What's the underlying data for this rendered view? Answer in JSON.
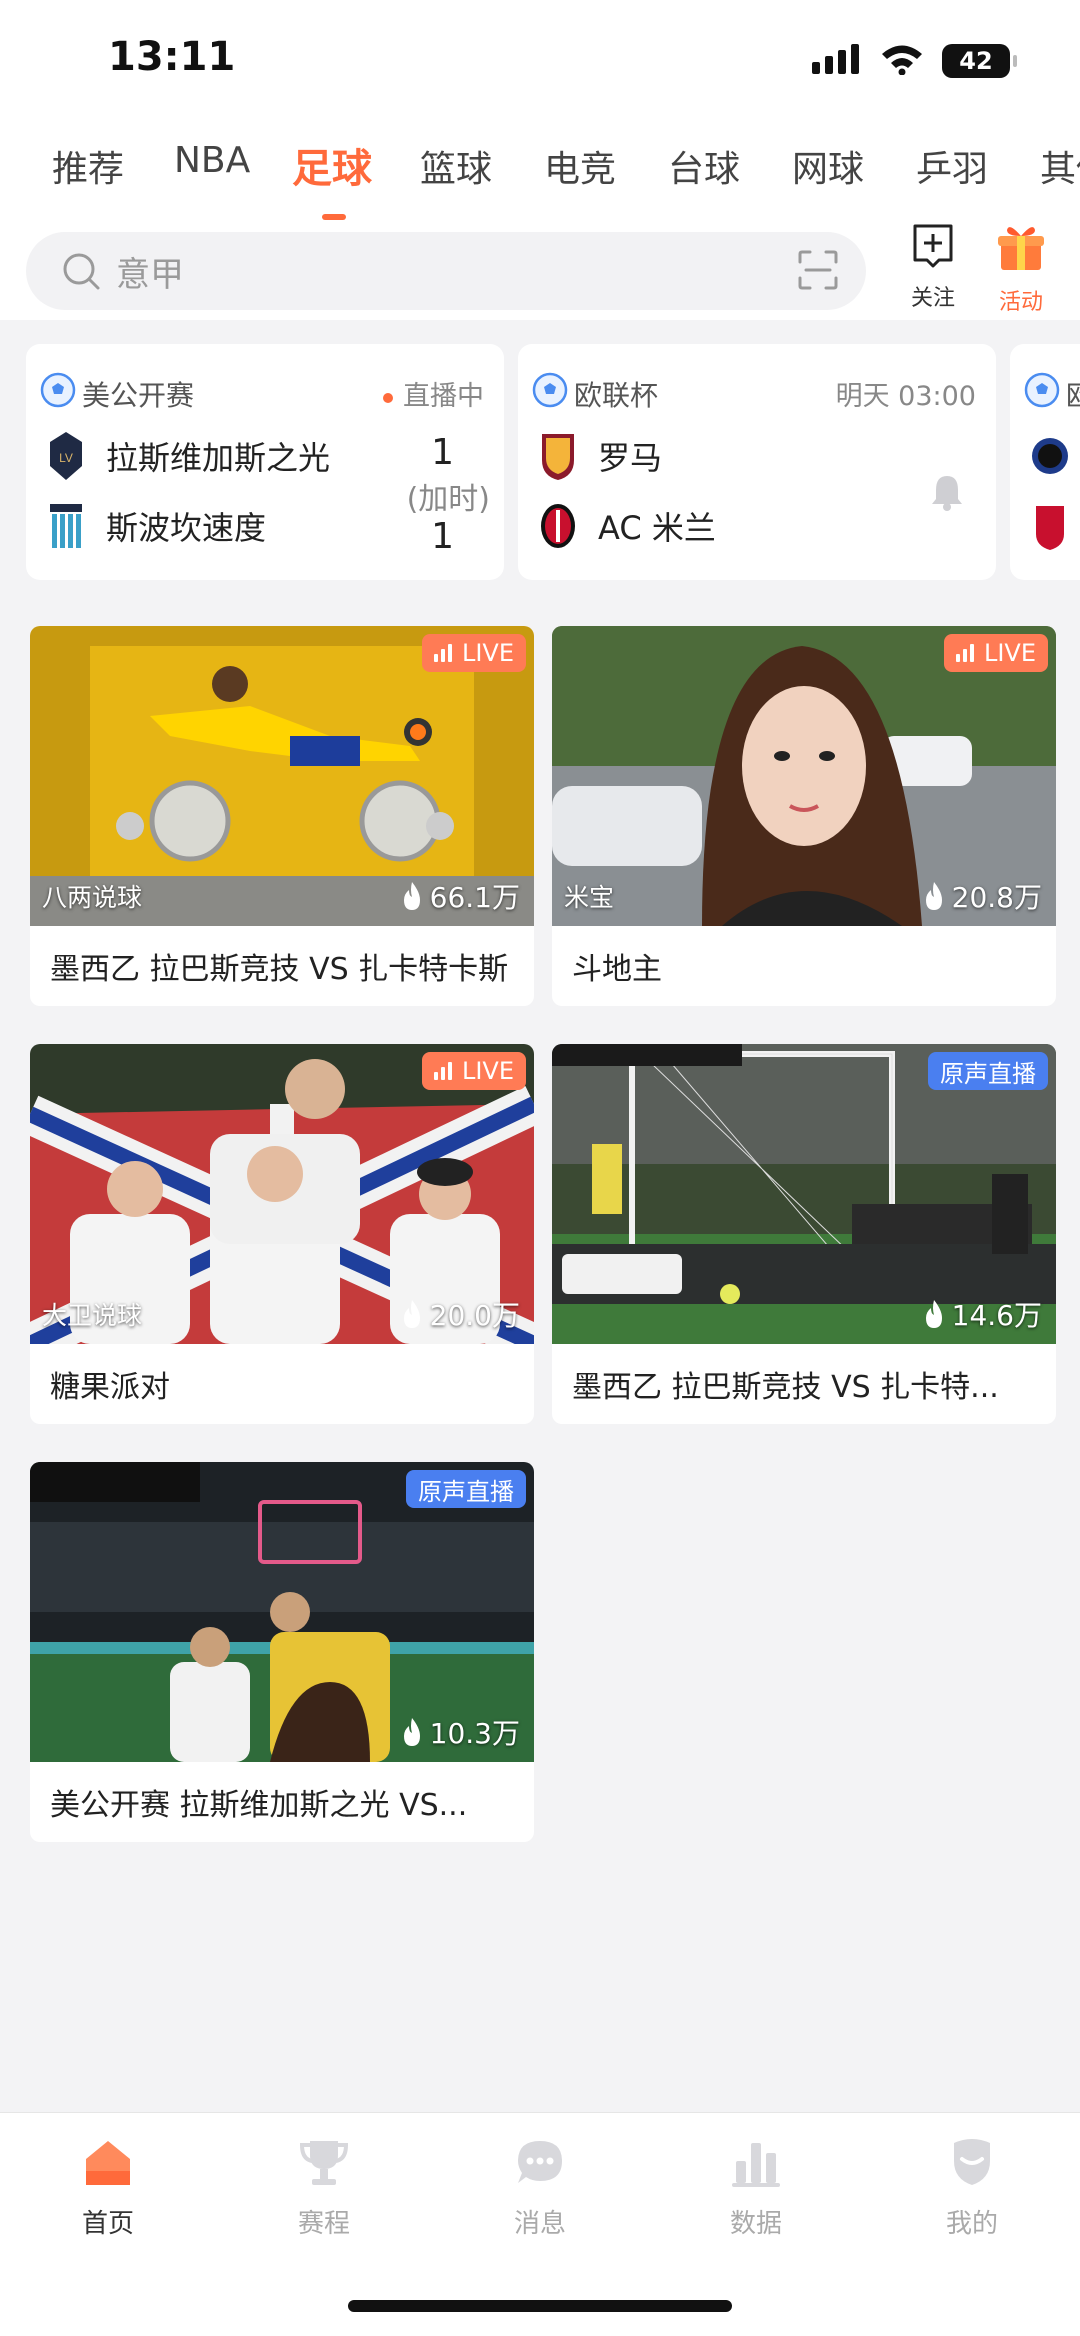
{
  "status_bar": {
    "time": "13:11",
    "battery": "42"
  },
  "tabs": [
    {
      "label": "推荐"
    },
    {
      "label": "NBA"
    },
    {
      "label": "足球"
    },
    {
      "label": "篮球"
    },
    {
      "label": "电竞"
    },
    {
      "label": "台球"
    },
    {
      "label": "网球"
    },
    {
      "label": "乒羽"
    },
    {
      "label": "其他"
    }
  ],
  "active_tab": "足球",
  "search": {
    "placeholder": "意甲"
  },
  "header_actions": {
    "follow_label": "关注",
    "activity_label": "活动"
  },
  "matches": [
    {
      "league": "美公开赛",
      "status": "直播中",
      "home_team": "拉斯维加斯之光",
      "away_team": "斯波坎速度",
      "home_score": "1",
      "away_score": "1",
      "note": "(加时)"
    },
    {
      "league": "欧联杯",
      "status": "明天 03:00",
      "home_team": "罗马",
      "away_team": "AC 米兰"
    },
    {
      "league": "欧"
    }
  ],
  "videos": [
    {
      "badge": "LIVE",
      "anchor": "八两说球",
      "heat": "66.1万",
      "title": "墨西乙 拉巴斯竞技 VS 扎卡特卡斯"
    },
    {
      "badge": "LIVE",
      "anchor": "米宝",
      "heat": "20.8万",
      "title": "斗地主"
    },
    {
      "badge": "LIVE",
      "anchor": "大卫说球",
      "heat": "20.0万",
      "title": "糖果派对"
    },
    {
      "badge": "原声直播",
      "anchor": "",
      "heat": "14.6万",
      "title": "墨西乙 拉巴斯竞技 VS 扎卡特..."
    },
    {
      "badge": "原声直播",
      "anchor": "",
      "heat": "10.3万",
      "title": "美公开赛 拉斯维加斯之光 VS..."
    }
  ],
  "bottom_nav": [
    {
      "label": "首页"
    },
    {
      "label": "赛程"
    },
    {
      "label": "消息"
    },
    {
      "label": "数据"
    },
    {
      "label": "我的"
    }
  ],
  "colors": {
    "accent": "#ff6a3b",
    "live_badge": "#ff7b55",
    "original_badge": "#4a7ff0",
    "background": "#f3f3f5"
  }
}
